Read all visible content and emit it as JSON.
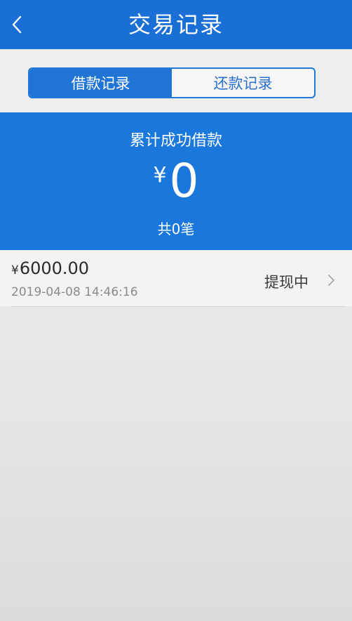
{
  "header": {
    "title": "交易记录",
    "back_icon": "chevron-left-icon"
  },
  "tabs": [
    {
      "label": "借款记录",
      "active": true
    },
    {
      "label": "还款记录",
      "active": false
    }
  ],
  "summary": {
    "label": "累计成功借款",
    "currency": "¥",
    "amount": "0",
    "count_text": "共0笔"
  },
  "records": [
    {
      "currency": "¥",
      "amount": "6000.00",
      "time": "2019-04-08 14:46:16",
      "status": "提现中"
    }
  ],
  "colors": {
    "primary": "#1a6fd6",
    "summary_bg": "#1a78dc"
  }
}
